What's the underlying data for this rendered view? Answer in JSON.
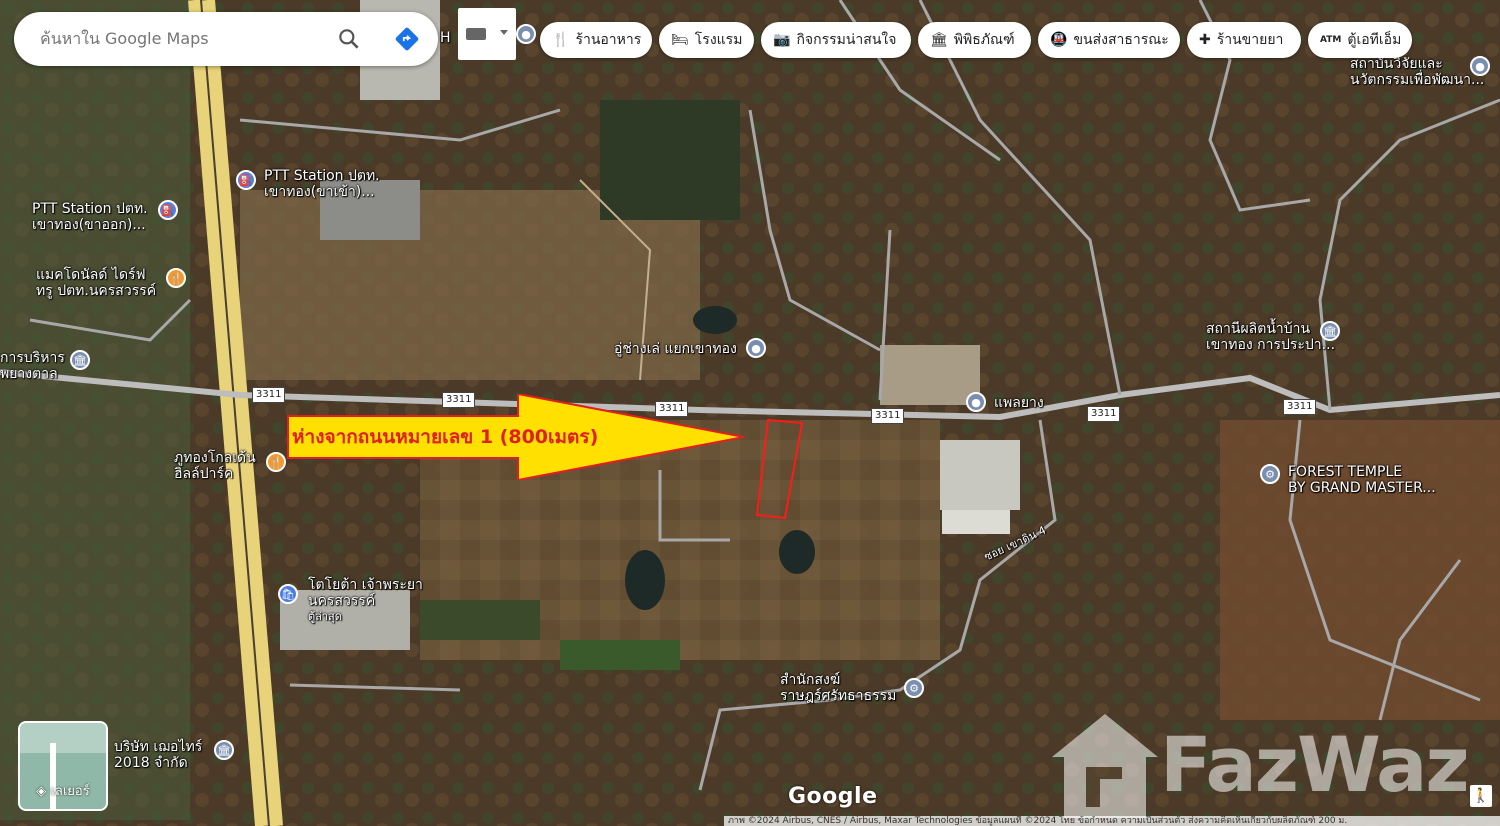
{
  "search": {
    "placeholder": "ค้นหาใน Google Maps"
  },
  "chips": [
    {
      "icon": "restaurant-icon",
      "label": "ร้านอาหาร"
    },
    {
      "icon": "hotel-icon",
      "label": "โรงแรม"
    },
    {
      "icon": "camera-icon",
      "label": "กิจกรรมน่าสนใจ"
    },
    {
      "icon": "museum-icon",
      "label": "พิพิธภัณฑ์"
    },
    {
      "icon": "transit-icon",
      "label": "ขนส่งสาธารณะ"
    },
    {
      "icon": "pharmacy-icon",
      "label": "ร้านขายยา"
    },
    {
      "icon": "atm-icon",
      "label": "ตู้เอทีเอ็ม"
    }
  ],
  "places": {
    "ptt_in": "PTT Station ปตท.\nเขาทอง(ขาเข้า)...",
    "ptt_out": "PTT Station ปตท.\nเขาทอง(ขาออก)...",
    "mcdonalds": "แมคโดนัลด์ ไดร์ฟ\nทรู ปตท.นครสวรรค์",
    "admin": "การบริหาร\nพยางตาล",
    "garage": "อู่ช่างเล่ แยกเขาทอง",
    "rubber": "แพลยาง",
    "water": "สถานีผลิตน้ำบ้าน\nเขาทอง การประปา...",
    "forest": "FOREST TEMPLE\nBY GRAND MASTER...",
    "institute": "สถาบันวิจัยและ\nนวัตกรรมเพื่อพัฒนา...",
    "golf": "ภูทองโกลเด้น\nฮิลล์ปาร์ค",
    "toyota": "โตโยต้า เจ้าพระยา\nนครสวรรค์",
    "toyota_sub": "ตู้ล่าสุด",
    "temple": "สำนักสงฆ์\nราษฎร์ศรัทธาธรรม",
    "company": "บริษัท เฌอไทร์\n2018 จำกัด",
    "soi": "ซอย เขาดิน 4",
    "top_h": "H"
  },
  "road_shields": [
    "3311",
    "3311",
    "3311",
    "3311",
    "3311"
  ],
  "annotation": "ห่างจากถนนหมายเลข 1 (800เมตร)",
  "layer_label": "เลเยอร์",
  "google_logo": "Google",
  "watermark": "FazWaz",
  "attribution": "ภาพ ©2024 Airbus, CNES / Airbus, Maxar Technologies ข้อมูลแผนที่ ©2024   ไทย   ข้อกำหนด   ความเป็นส่วนตัว   ส่งความคิดเห็นเกี่ยวกับผลิตภัณฑ์   200 ม.",
  "colors": {
    "arrow_fill": "#ffe000",
    "arrow_text": "#e02020",
    "plot_outline": "#ff1a1a",
    "highway": "#e8d27a",
    "road": "#b8b8b8"
  }
}
